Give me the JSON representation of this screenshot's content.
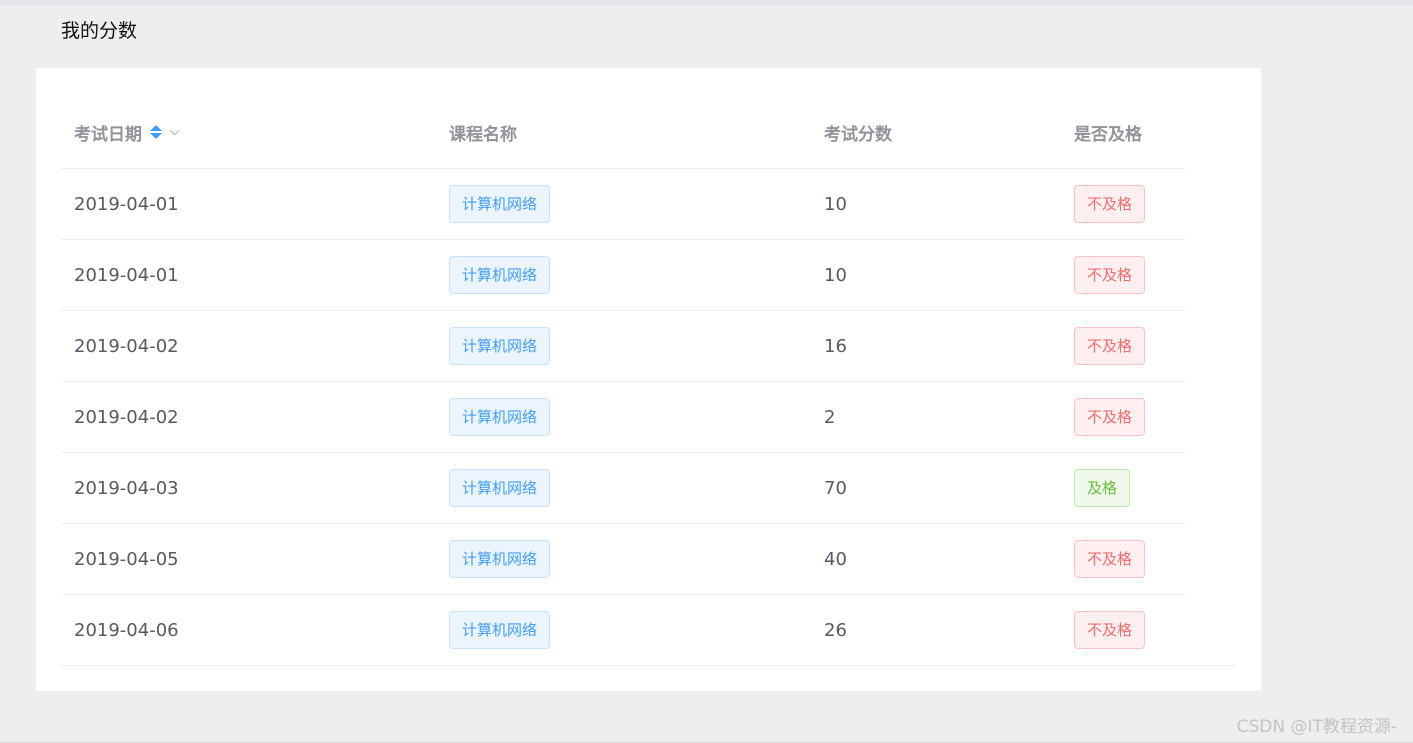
{
  "page_title": "我的分数",
  "table": {
    "columns": [
      {
        "label": "考试日期",
        "sortable": true
      },
      {
        "label": "课程名称",
        "sortable": false
      },
      {
        "label": "考试分数",
        "sortable": false
      },
      {
        "label": "是否及格",
        "sortable": false
      }
    ],
    "rows": [
      {
        "date": "2019-04-01",
        "course": "计算机网络",
        "score": "10",
        "status": "不及格",
        "pass": false
      },
      {
        "date": "2019-04-01",
        "course": "计算机网络",
        "score": "10",
        "status": "不及格",
        "pass": false
      },
      {
        "date": "2019-04-02",
        "course": "计算机网络",
        "score": "16",
        "status": "不及格",
        "pass": false
      },
      {
        "date": "2019-04-02",
        "course": "计算机网络",
        "score": "2",
        "status": "不及格",
        "pass": false
      },
      {
        "date": "2019-04-03",
        "course": "计算机网络",
        "score": "70",
        "status": "及格",
        "pass": true
      },
      {
        "date": "2019-04-05",
        "course": "计算机网络",
        "score": "40",
        "status": "不及格",
        "pass": false
      },
      {
        "date": "2019-04-06",
        "course": "计算机网络",
        "score": "26",
        "status": "不及格",
        "pass": false
      }
    ]
  },
  "watermark": "CSDN @IT教程资源-",
  "icons": {
    "sort": "sort-caret-icon",
    "dropdown": "chevron-down-icon"
  },
  "colors": {
    "course_tag": "#409eff",
    "fail_tag": "#f56c6c",
    "pass_tag": "#67c23a",
    "sort_active": "#409eff"
  }
}
